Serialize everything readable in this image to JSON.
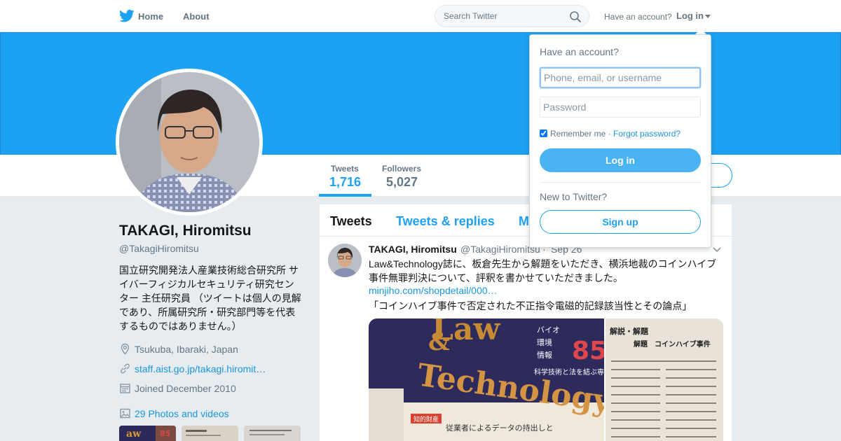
{
  "nav": {
    "home_label": "Home",
    "about_label": "About",
    "search_placeholder": "Search Twitter",
    "have_account": "Have an account?",
    "login_label": "Log in"
  },
  "profile": {
    "name": "TAKAGI, Hiromitsu",
    "handle": "@TakagiHiromitsu",
    "bio": "国立研究開発法人産業技術総合研究所 サイバーフィジカルセキュリティ研究センター 主任研究員 （ツイートは個人の見解であり、所属研究所・研究部門等を代表するものではありません。）",
    "location": "Tsukuba, Ibaraki, Japan",
    "website": "staff.aist.go.jp/takagi.hiromit…",
    "joined": "Joined December 2010",
    "media_label": "29 Photos and videos"
  },
  "stats": [
    {
      "label": "Tweets",
      "value": "1,716"
    },
    {
      "label": "Followers",
      "value": "5,027"
    }
  ],
  "tabs": [
    {
      "label": "Tweets"
    },
    {
      "label": "Tweets & replies"
    },
    {
      "label": "M"
    }
  ],
  "tweet": {
    "name": "TAKAGI, Hiromitsu",
    "handle": "@TakagiHiromitsu",
    "dot": "·",
    "time": "Sep 26",
    "text": "Law&Technology誌に、板倉先生から解題をいただき、横浜地裁のコインハイブ事件無罪判決について、評釈を書かせていただきました。",
    "link": "minjiho.com/shopdetail/000…",
    "quote": "「コインハイブ事件で否定された不正指令電磁的記録該当性とその論点」",
    "media": {
      "magazine_title_1": "Law",
      "magazine_amp": "&",
      "magazine_title_2": "Technology",
      "issue_number": "85",
      "topics": [
        "バイオ",
        "環境",
        "情報"
      ],
      "subtitle": "科学技術と法を結ぶ専門情報誌",
      "tag": "知的財産",
      "bottom_text": "従業者によるデータの持出しと",
      "right_header_1": "解説・解題",
      "right_header_2": "解題　コインハイブ事件"
    }
  },
  "login_dropdown": {
    "title": "Have an account?",
    "username_placeholder": "Phone, email, or username",
    "password_placeholder": "Password",
    "remember": "Remember me",
    "sep": " · ",
    "forgot": "Forgot password?",
    "login_button": "Log in",
    "new_to": "New to Twitter?",
    "signup_button": "Sign up"
  },
  "colors": {
    "brand": "#1da1f2",
    "link": "#1b95e0",
    "muted": "#657786"
  },
  "icons": [
    "twitter-bird-icon",
    "search-icon",
    "location-icon",
    "link-icon",
    "calendar-icon",
    "photo-icon",
    "chevron-down-icon"
  ]
}
